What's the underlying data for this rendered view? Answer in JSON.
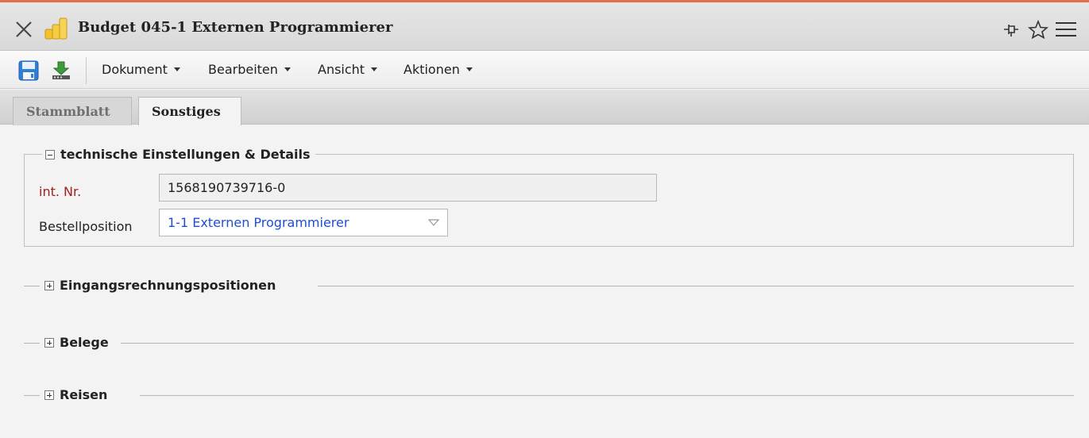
{
  "window": {
    "title": "Budget 045-1 Externen Programmierer",
    "accent_color": "#e0704a",
    "icons": [
      "close-icon",
      "coins-icon",
      "pin-icon",
      "star-icon",
      "hamburger-menu-icon"
    ]
  },
  "toolbar": {
    "icons": [
      "save-icon",
      "download-icon"
    ],
    "menus": [
      {
        "label": "Dokument"
      },
      {
        "label": "Bearbeiten"
      },
      {
        "label": "Ansicht"
      },
      {
        "label": "Aktionen"
      }
    ]
  },
  "tabs": [
    {
      "label": "Stammblatt",
      "active": false
    },
    {
      "label": "Sonstiges",
      "active": true
    }
  ],
  "technical_details": {
    "title": "technische Einstellungen & Details",
    "expanded": true,
    "int_nr": {
      "label": "int. Nr.",
      "value": "1568190739716-0"
    },
    "bestellposition": {
      "label": "Bestellposition",
      "value": "1-1 Externen Programmierer"
    }
  },
  "sections": [
    {
      "title": "Eingangsrechnungspositionen",
      "expanded": false
    },
    {
      "title": "Belege",
      "expanded": false
    },
    {
      "title": "Reisen",
      "expanded": false
    }
  ]
}
